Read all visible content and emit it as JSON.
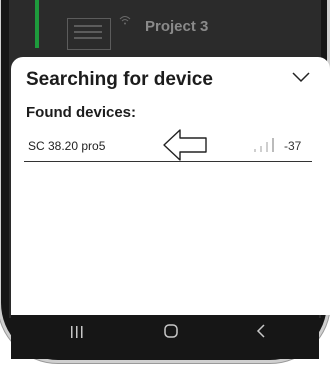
{
  "background_project": {
    "title": "Project 3",
    "icon": "wifi-icon",
    "accent": "#1e9a3c"
  },
  "sheet": {
    "title": "Searching for device",
    "collapse_icon": "chevron-down-icon",
    "found_label": "Found devices:",
    "devices": [
      {
        "name": "SC 38.20 pro5",
        "rssi": "-37",
        "signal_icon": "signal-bars-icon"
      }
    ]
  },
  "nav": {
    "recents_icon": "recents-icon",
    "home_icon": "home-icon",
    "back_icon": "back-icon"
  },
  "annotation": {
    "arrow_icon": "left-arrow-pointer-icon"
  }
}
